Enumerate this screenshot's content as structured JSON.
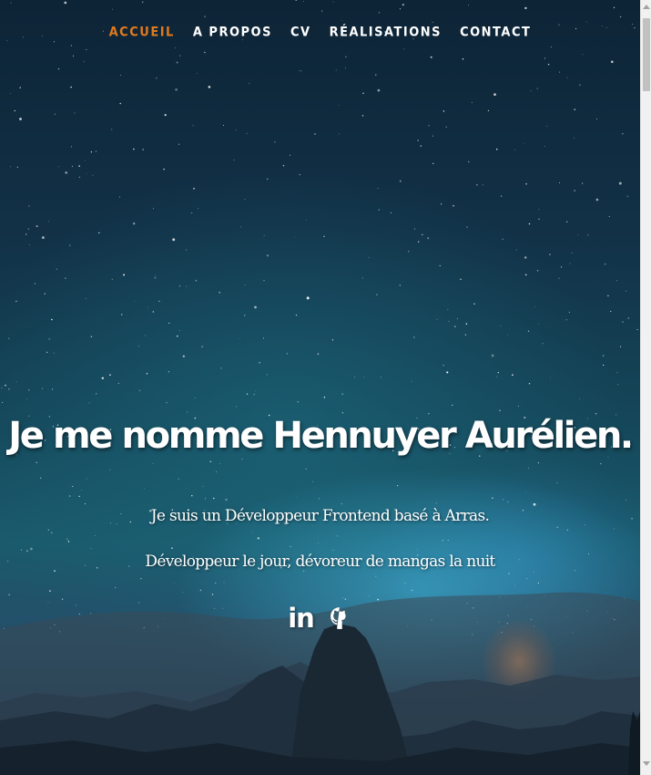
{
  "nav": {
    "items": [
      {
        "label": "ACCUEIL",
        "active": true
      },
      {
        "label": "A PROPOS",
        "active": false
      },
      {
        "label": "CV",
        "active": false
      },
      {
        "label": "RÉALISATIONS",
        "active": false
      },
      {
        "label": "CONTACT",
        "active": false
      }
    ]
  },
  "hero": {
    "title": "Je me nomme Hennuyer Aurélien.",
    "subtitle": "Je suis un Développeur Frontend basé à Arras. Développeur le jour, dévoreur de mangas la nuit"
  },
  "social": {
    "linkedin_icon": "linkedin-icon",
    "linkedin_text": "in",
    "github_icon": "github-icon"
  },
  "colors": {
    "accent": "#e07a1f",
    "text": "#ffffff"
  }
}
